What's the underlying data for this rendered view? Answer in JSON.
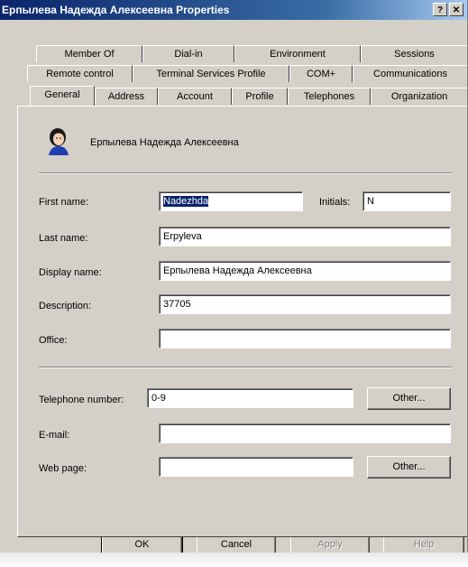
{
  "window": {
    "title": "Ерпылева Надежда Алексеевна Properties",
    "help_label": "?",
    "close_label": "✕"
  },
  "tabs": {
    "row1": [
      {
        "label": "Member Of"
      },
      {
        "label": "Dial-in"
      },
      {
        "label": "Environment"
      },
      {
        "label": "Sessions"
      }
    ],
    "row2": [
      {
        "label": "Remote control"
      },
      {
        "label": "Terminal Services Profile"
      },
      {
        "label": "COM+"
      },
      {
        "label": "Communications"
      }
    ],
    "row3": [
      {
        "label": "General",
        "active": true
      },
      {
        "label": "Address"
      },
      {
        "label": "Account"
      },
      {
        "label": "Profile"
      },
      {
        "label": "Telephones"
      },
      {
        "label": "Organization"
      }
    ]
  },
  "general": {
    "icon": "user-icon",
    "display_header": "Ерпылева Надежда Алексеевна",
    "first_name_label": "First name:",
    "first_name_value": "Nadezhda",
    "initials_label": "Initials:",
    "initials_value": "N",
    "last_name_label": "Last name:",
    "last_name_value": "Erpyleva",
    "display_name_label": "Display name:",
    "display_name_value": "Ерпылева Надежда Алексеевна",
    "description_label": "Description:",
    "description_value": "37705",
    "office_label": "Office:",
    "office_value": "",
    "telephone_label": "Telephone number:",
    "telephone_value": "0-9",
    "other_tel_label": "Other...",
    "email_label": "E-mail:",
    "email_value": "",
    "webpage_label": "Web page:",
    "webpage_value": "",
    "other_web_label": "Other..."
  },
  "footer": {
    "ok_label": "OK",
    "cancel_label": "Cancel",
    "apply_label": "Apply",
    "help_label": "Help"
  },
  "colors": {
    "titlebar": "#0a246a",
    "dialog_face": "#d4d0c8",
    "selection": "#0a246a"
  }
}
